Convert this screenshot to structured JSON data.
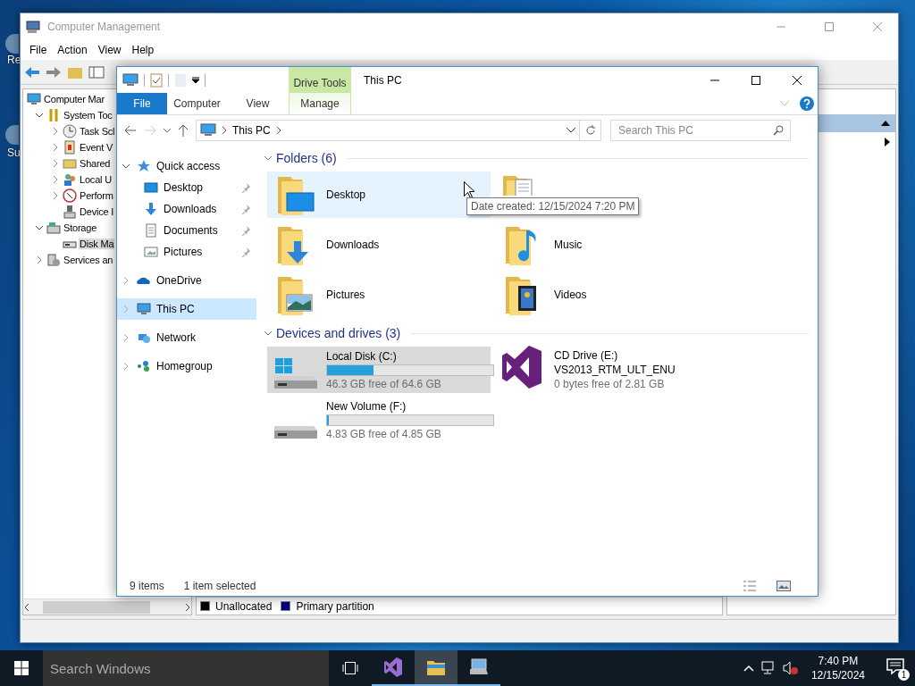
{
  "desktop_icons": [
    {
      "label": "Re"
    },
    {
      "label": "Su"
    }
  ],
  "management": {
    "title": "Computer Management",
    "menu": [
      "File",
      "Action",
      "View",
      "Help"
    ],
    "tree": [
      {
        "label": "Computer Mar",
        "kind": "computer",
        "selected": false,
        "children": [
          {
            "label": "System Toc",
            "kind": "tools",
            "expanded": true,
            "selected": false,
            "children": [
              {
                "label": "Task Scl",
                "kind": "clock",
                "expanded": false,
                "selected": false
              },
              {
                "label": "Event V",
                "kind": "event",
                "expanded": false,
                "selected": false
              },
              {
                "label": "Shared",
                "kind": "shared",
                "expanded": false,
                "selected": false
              },
              {
                "label": "Local U",
                "kind": "users",
                "expanded": false,
                "selected": false
              },
              {
                "label": "Perform",
                "kind": "performance",
                "expanded": false,
                "selected": false
              },
              {
                "label": "Device I",
                "kind": "device",
                "selected": false
              }
            ]
          },
          {
            "label": "Storage",
            "kind": "storage",
            "expanded": true,
            "selected": false,
            "children": [
              {
                "label": "Disk Ma",
                "kind": "disk",
                "selected": true
              }
            ]
          },
          {
            "label": "Services an",
            "kind": "services",
            "expanded": false,
            "selected": false
          }
        ]
      }
    ],
    "legend": [
      {
        "label": "Unallocated",
        "color": "#000000"
      },
      {
        "label": "Primary partition",
        "color": "#000080"
      }
    ]
  },
  "explorer": {
    "title": "This PC",
    "context_group": "Drive Tools",
    "tabs": [
      {
        "label": "File",
        "kind": "file",
        "selected": false
      },
      {
        "label": "Computer",
        "kind": "normal",
        "selected": false
      },
      {
        "label": "View",
        "kind": "normal",
        "selected": false
      },
      {
        "label": "Manage",
        "kind": "context",
        "selected": false
      }
    ],
    "address": [
      "This PC"
    ],
    "search": {
      "placeholder": "Search This PC"
    },
    "nav": [
      {
        "label": "Quick access",
        "kind": "star",
        "expanded": true,
        "selected": false,
        "children": [
          {
            "label": "Desktop",
            "kind": "desktop",
            "pinned": true,
            "selected": false
          },
          {
            "label": "Downloads",
            "kind": "downloads",
            "pinned": true,
            "selected": false
          },
          {
            "label": "Documents",
            "kind": "documents",
            "pinned": true,
            "selected": false
          },
          {
            "label": "Pictures",
            "kind": "pictures",
            "pinned": true,
            "selected": false
          }
        ]
      },
      {
        "label": "OneDrive",
        "kind": "cloud",
        "expanded": false,
        "selected": false
      },
      {
        "label": "This PC",
        "kind": "computer",
        "expanded": false,
        "selected": true
      },
      {
        "label": "Network",
        "kind": "network",
        "expanded": false,
        "selected": false
      },
      {
        "label": "Homegroup",
        "kind": "homegroup",
        "expanded": false,
        "selected": false
      }
    ],
    "sections": [
      {
        "title": "Folders (6)",
        "expanded": true,
        "items": [
          {
            "kind": "desktop",
            "label": "Desktop",
            "hover": true,
            "selected": false
          },
          {
            "kind": "documents",
            "hover": false,
            "selected": false
          },
          {
            "kind": "downloads",
            "label": "Downloads",
            "hover": false,
            "selected": false
          },
          {
            "kind": "music",
            "label": "Music",
            "hover": false,
            "selected": false
          },
          {
            "kind": "pictures",
            "label": "Pictures",
            "hover": false,
            "selected": false
          },
          {
            "kind": "videos",
            "label": "Videos",
            "hover": false,
            "selected": false
          }
        ]
      },
      {
        "title": "Devices and drives (3)",
        "expanded": true,
        "items": [
          {
            "kind": "system",
            "label": "Local Disk (C:)",
            "level": 0.28,
            "free": "46.3 GB free of 64.6 GB",
            "hover": false,
            "selected": true
          },
          {
            "kind": "disc",
            "label": "CD Drive (E:)",
            "subtitle": "VS2013_RTM_ULT_ENU",
            "free": "0 bytes free of 2.81 GB",
            "hover": false,
            "selected": false
          },
          {
            "kind": "volume",
            "label": "New Volume (F:)",
            "level": 0.01,
            "free": "4.83 GB free of 4.85 GB",
            "hover": false,
            "selected": false
          }
        ]
      }
    ],
    "tooltip": "Date created: 12/15/2024 7:20 PM",
    "status": {
      "count": "9 items",
      "selection": "1 item selected"
    }
  },
  "taskbar": {
    "search": {
      "placeholder": "Search Windows"
    },
    "apps": [
      {
        "kind": "visual-studio",
        "active": false
      },
      {
        "kind": "explorer",
        "active": true
      },
      {
        "kind": "management",
        "active": false
      }
    ],
    "time": "7:40 PM",
    "date": "12/15/2024",
    "notifications": "1"
  }
}
